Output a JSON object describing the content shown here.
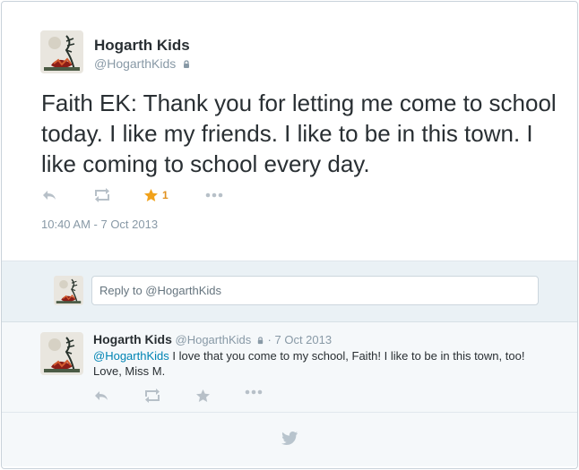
{
  "main_tweet": {
    "author_name": "Hogarth Kids",
    "author_handle": "@HogarthKids",
    "text": "Faith EK: Thank you for letting me come to school today. I like my friends. I like to be in this town. I like coming to school every day.",
    "favorite_count": "1",
    "timestamp": "10:40 AM - 7 Oct 2013",
    "icons": {
      "reply": "reply-icon",
      "retweet": "retweet-icon",
      "favorite": "favorite-star-icon",
      "more": "more-dots-icon",
      "lock": "lock-icon"
    }
  },
  "reply_box": {
    "placeholder": "Reply to @HogarthKids"
  },
  "reply_tweet": {
    "author_name": "Hogarth Kids",
    "author_handle": "@HogarthKids",
    "separator": "·",
    "date": "7 Oct 2013",
    "mention": "@HogarthKids",
    "text": " I love that you come to my school, Faith! I like to be in this town, too! Love, Miss M.",
    "icons": {
      "reply": "reply-icon",
      "retweet": "retweet-icon",
      "favorite": "favorite-star-icon",
      "more": "more-dots-icon",
      "lock": "lock-icon"
    }
  },
  "footer": {
    "logo": "twitter-bird-icon"
  },
  "colors": {
    "text": "#292f33",
    "secondary_text": "#8899a6",
    "link": "#0084b4",
    "favorite": "#f1a21b",
    "reply_box_background": "#eaf1f5",
    "footer_background": "#f5f8fa"
  }
}
